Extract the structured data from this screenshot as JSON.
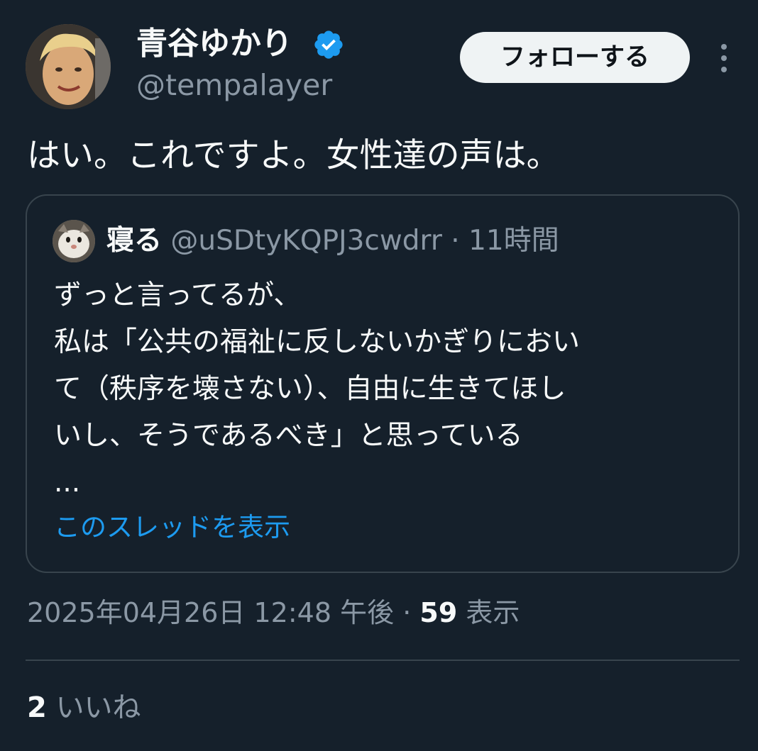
{
  "author": {
    "display_name": "青谷ゆかり",
    "handle": "@tempalayer",
    "verified_icon": "verified-badge-icon",
    "avatar_icon": "user-photo-avatar"
  },
  "actions": {
    "follow_label": "フォローする",
    "more_icon": "more-vertical-icon"
  },
  "tweet": {
    "text": "はい。これですよ。女性達の声は。"
  },
  "quote": {
    "avatar_icon": "cat-photo-avatar",
    "name": "寝る",
    "handle": "@uSDtyKQPJ3cwdrr",
    "separator": "·",
    "time": "11時間",
    "lines": [
      "ずっと言ってるが、",
      "私は「公共の福祉に反しないかぎりにおい",
      "て（秩序を壊さない）、自由に生きてほし",
      "いし、そうであるべき」と思っている",
      "..."
    ],
    "show_thread_label": "このスレッドを表示"
  },
  "meta": {
    "datetime": "2025年04月26日 12:48 午後",
    "separator": "·",
    "views_count": "59",
    "views_label": "表示"
  },
  "engagement": {
    "likes_count": "2",
    "likes_label": "いいね"
  },
  "colors": {
    "background": "#15202b",
    "primary_text": "#f7f9f9",
    "secondary_text": "#8b98a5",
    "link": "#1d9bf0",
    "border": "#38444d",
    "verified": "#1d9bf0",
    "follow_button_bg": "#eff3f4"
  }
}
